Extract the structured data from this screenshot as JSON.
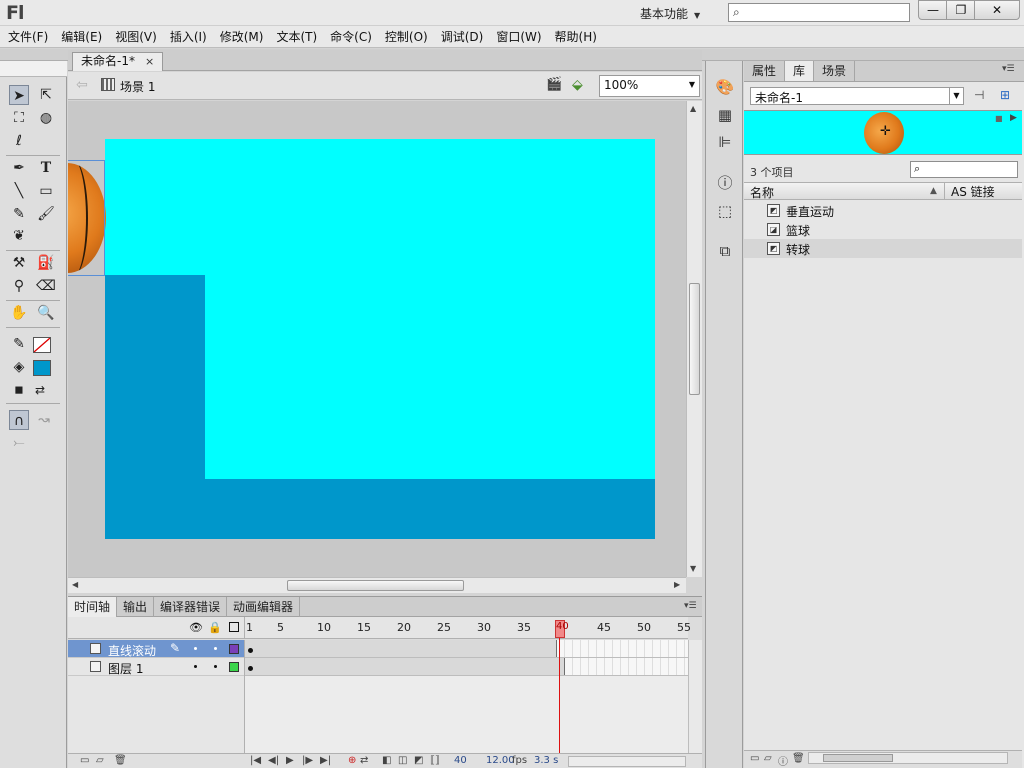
{
  "app": {
    "logo": "Fl"
  },
  "titlebar": {
    "workspace": "基本功能",
    "search_placeholder": ""
  },
  "menu": [
    "文件(F)",
    "编辑(E)",
    "视图(V)",
    "插入(I)",
    "修改(M)",
    "文本(T)",
    "命令(C)",
    "控制(O)",
    "调试(D)",
    "窗口(W)",
    "帮助(H)"
  ],
  "document": {
    "tab": "未命名-1*",
    "close": "×"
  },
  "editbar": {
    "scene": "场景 1",
    "zoom": "100%"
  },
  "stage": {
    "background": "#00ffff",
    "shape_color": "#0097cb"
  },
  "bottom_tabs": [
    "时间轴",
    "输出",
    "编译器错误",
    "动画编辑器"
  ],
  "timeline": {
    "ruler": [
      "1",
      "5",
      "10",
      "15",
      "20",
      "25",
      "30",
      "35",
      "40",
      "45",
      "50",
      "55"
    ],
    "current_frame_label": "40",
    "layers": [
      {
        "name": "直线滚动",
        "selected": true,
        "color": "#7a3fb8"
      },
      {
        "name": "图层 1",
        "selected": false,
        "color": "#3ad44a"
      }
    ],
    "footer": {
      "frame": "40",
      "fps": "12.00",
      "fps_unit": "fps",
      "time": "3.3 s"
    }
  },
  "library": {
    "tabs": [
      "属性",
      "库",
      "场景"
    ],
    "active_tab": "库",
    "document": "未命名-1",
    "count": "3 个项目",
    "col_name": "名称",
    "col_as": "AS 链接",
    "items": [
      {
        "name": "垂直运动",
        "selected": false
      },
      {
        "name": "篮球",
        "selected": false
      },
      {
        "name": "转球",
        "selected": true
      }
    ]
  },
  "icons": {
    "tools": [
      "selection-arrow-icon",
      "subselection-icon",
      "free-transform-icon",
      "3d-rotation-icon",
      "lasso-icon",
      "pen-icon",
      "text-icon",
      "line-icon",
      "rectangle-icon",
      "pencil-icon",
      "brush-icon",
      "deco-icon",
      "bone-icon",
      "paint-bucket-icon",
      "eyedropper-icon",
      "eraser-icon",
      "hand-icon",
      "zoom-icon",
      "stroke-color-icon",
      "fill-color-icon",
      "black-white-icon",
      "swap-colors-icon",
      "snap-icon",
      "smooth-icon",
      "straighten-icon"
    ],
    "panels": [
      "color-palette-icon",
      "swatches-icon",
      "align-icon",
      "info-icon",
      "transform-icon",
      "components-icon"
    ]
  }
}
